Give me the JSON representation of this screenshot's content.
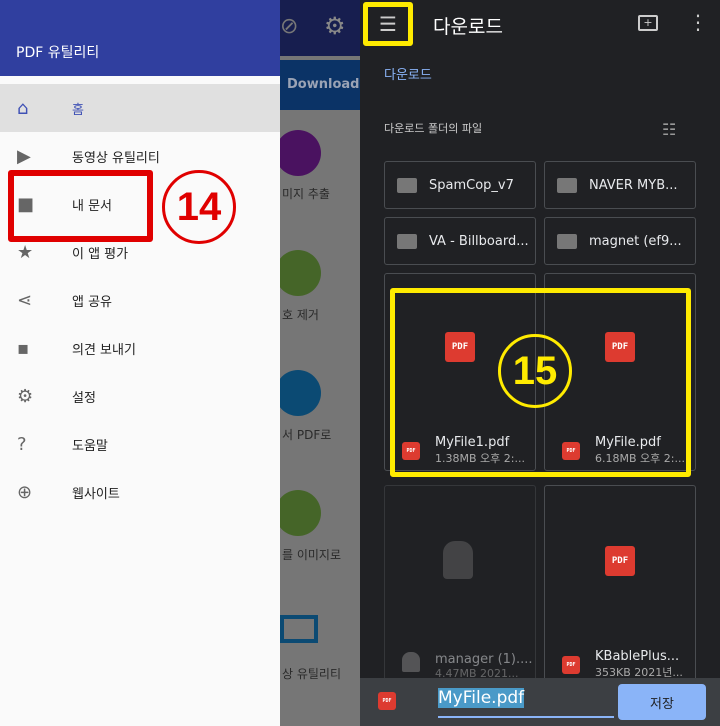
{
  "background_app": {
    "tab": "Download",
    "tools": [
      "미지 추출",
      "호 제거",
      "서 PDF로",
      "를 이미지로",
      "상 유틸리티"
    ]
  },
  "drawer": {
    "title": "PDF 유틸리티",
    "items": [
      {
        "label": "홈",
        "icon": "home-icon",
        "selected": true
      },
      {
        "label": "동영상 유틸리티",
        "icon": "video-icon"
      },
      {
        "label": "내 문서",
        "icon": "folder-icon"
      },
      {
        "label": "이 앱 평가",
        "icon": "star-icon"
      },
      {
        "label": "앱 공유",
        "icon": "share-icon"
      },
      {
        "label": "의견 보내기",
        "icon": "feedback-icon"
      },
      {
        "label": "설정",
        "icon": "gear-icon"
      },
      {
        "label": "도움말",
        "icon": "help-icon"
      },
      {
        "label": "웹사이트",
        "icon": "globe-icon"
      }
    ]
  },
  "picker": {
    "title": "다운로드",
    "breadcrumb": "다운로드",
    "section": "다운로드 폴더의 파일",
    "folders": [
      "SpamCop_v7",
      "NAVER MYB...",
      "VA - Billboard...",
      "magnet (ef9..."
    ],
    "files": [
      {
        "name": "MyFile1.pdf",
        "meta": "1.38MB 오후 2:...",
        "type": "pdf"
      },
      {
        "name": "MyFile.pdf",
        "meta": "6.18MB 오후 2:...",
        "type": "pdf"
      },
      {
        "name": "manager (1)....",
        "meta": "4.47MB 2021...",
        "type": "apk"
      },
      {
        "name": "KBablePlus...",
        "meta": "353KB 2021년...",
        "type": "pdf"
      }
    ],
    "filename": "MyFile.pdf",
    "save_label": "저장"
  },
  "annotations": {
    "a14": "14",
    "a15": "15"
  },
  "colors": {
    "drawer_header": "#303f9f",
    "accent": "#8ab4f8",
    "pdf": "#dd3b30",
    "annotation_red": "#e00000",
    "annotation_yellow": "#ffeb00"
  }
}
